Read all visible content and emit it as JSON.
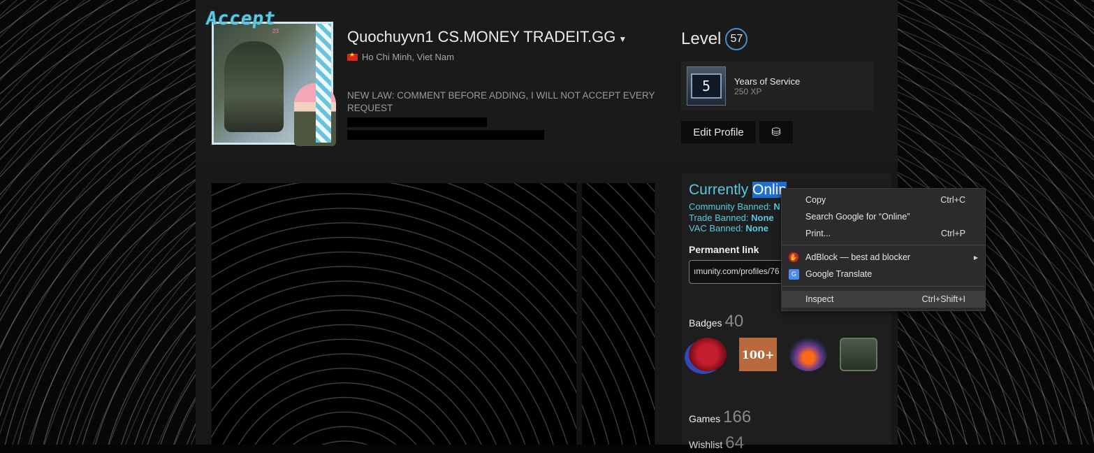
{
  "profile": {
    "frame_text": "Accept",
    "frame_sub": "23",
    "name": "Quochuyvn1 CS.MONEY TRADEIT.GG",
    "location": "Ho Chi Minh, Viet Nam",
    "summary": "NEW LAW: COMMENT BEFORE ADDING, I WILL NOT ACCEPT EVERY REQUEST",
    "level_label": "Level",
    "level": "57",
    "featured_badge": {
      "icon_text": "5",
      "title": "Years of Service",
      "xp": "250 XP"
    },
    "edit_button": "Edit Profile",
    "coins_icon": "coins-icon"
  },
  "status": {
    "prefix": "Currently ",
    "highlight": "Onlin",
    "community_label": "Community Banned: ",
    "community_value": "N",
    "trade_label": "Trade Banned: ",
    "trade_value": "None",
    "vac_label": "VAC Banned: ",
    "vac_value": "None"
  },
  "permanent_link": {
    "title": "Permanent link",
    "value": "ımunity.com/profiles/76"
  },
  "badges": {
    "label": "Badges",
    "count": "40",
    "items": [
      "red-seal-badge",
      "100-plus-badge",
      "volcano-badge",
      "radio-badge"
    ],
    "b2_text": "100+"
  },
  "games": {
    "label": "Games",
    "count": "166"
  },
  "wishlist": {
    "label": "Wishlist",
    "count": "64"
  },
  "context_menu": {
    "copy": "Copy",
    "copy_sc": "Ctrl+C",
    "search": "Search Google for “Online”",
    "print": "Print...",
    "print_sc": "Ctrl+P",
    "adblock": "AdBlock — best ad blocker",
    "translate": "Google Translate",
    "inspect": "Inspect",
    "inspect_sc": "Ctrl+Shift+I"
  }
}
